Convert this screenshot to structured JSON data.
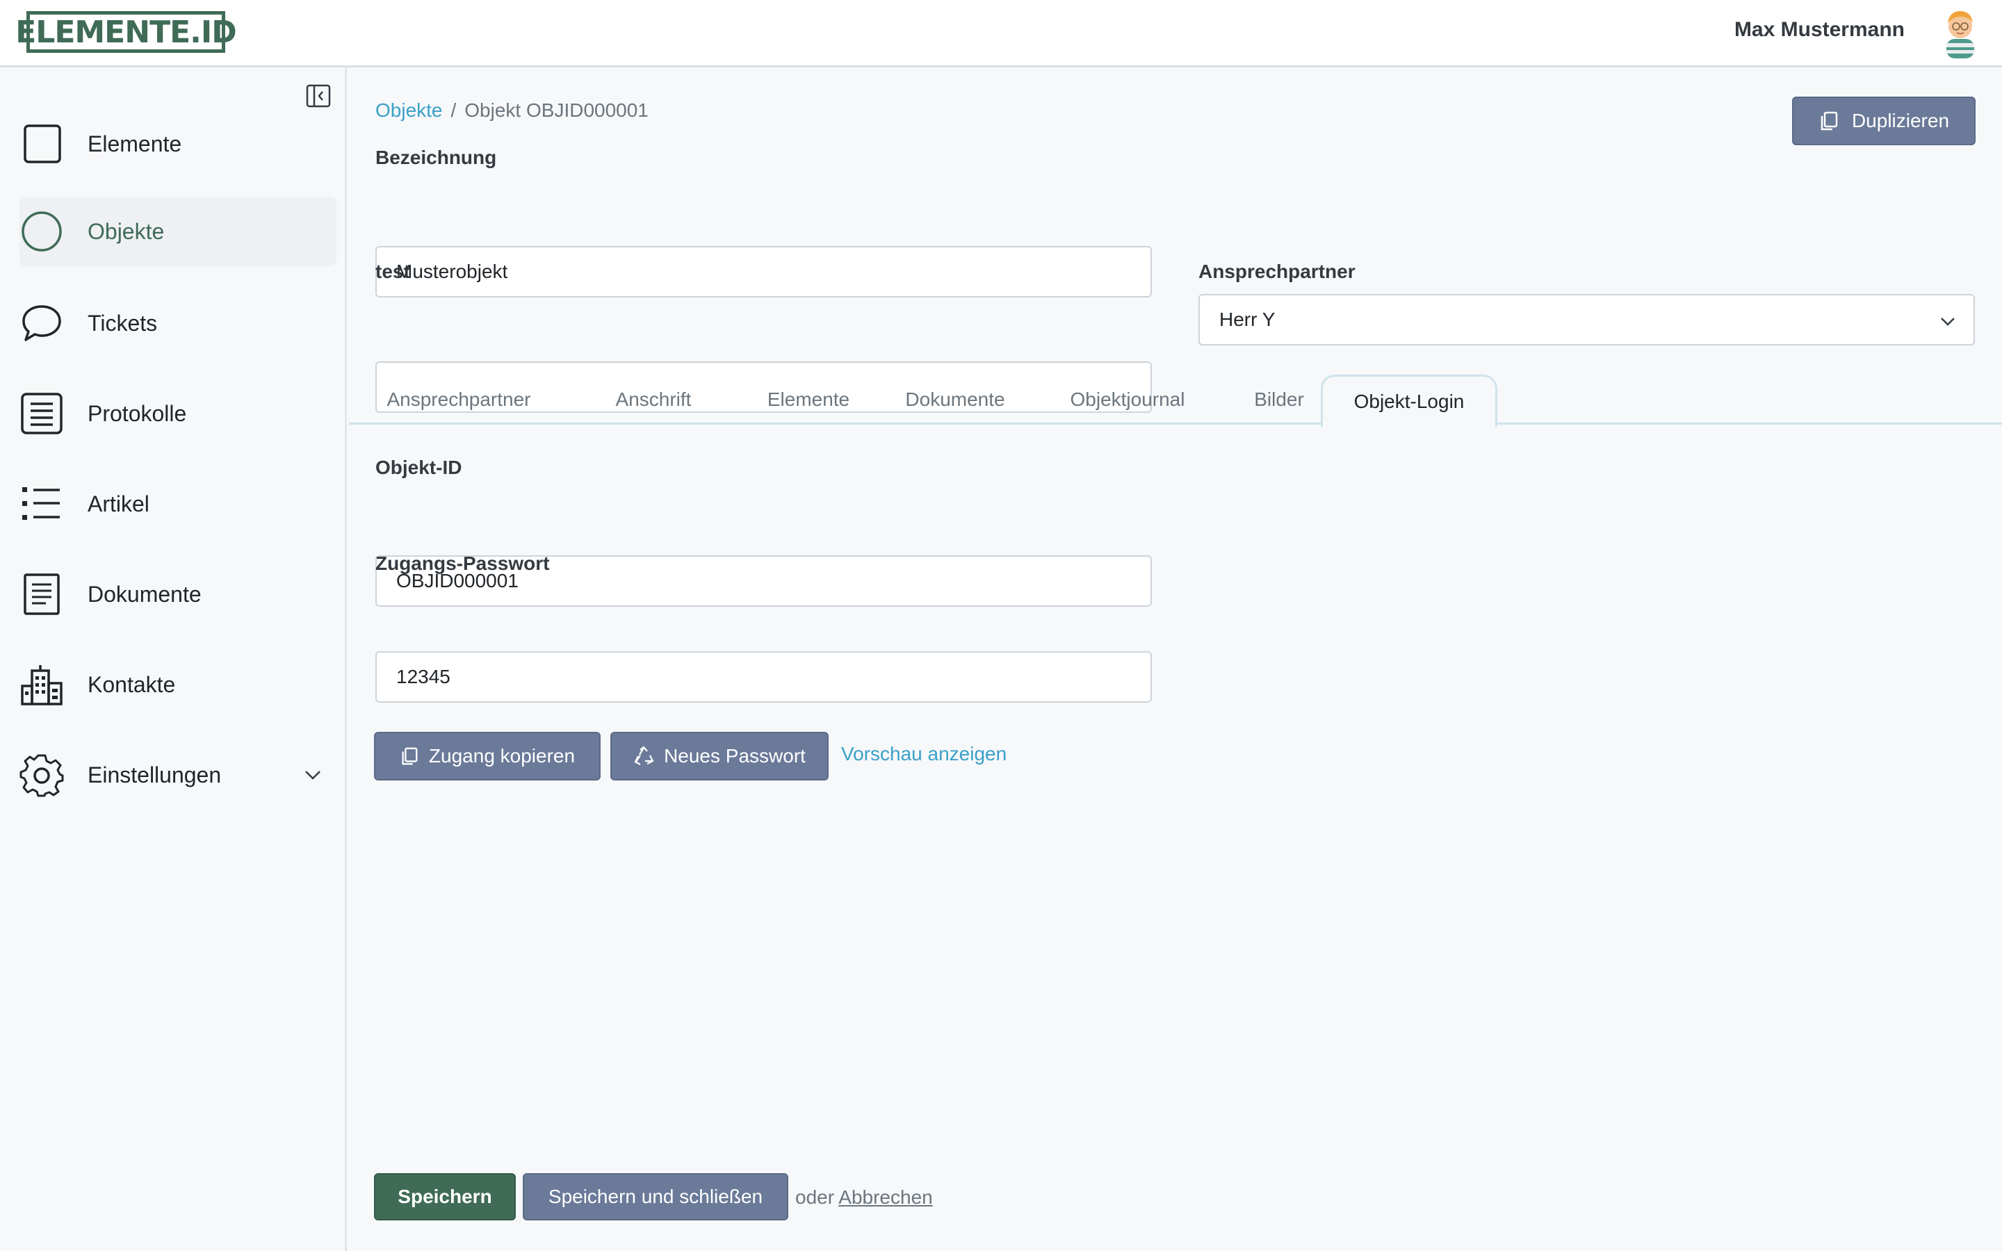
{
  "header": {
    "logo_text": "ELEMENTE.ID",
    "user_name": "Max Mustermann"
  },
  "sidebar": {
    "items": [
      {
        "label": "Elemente",
        "icon": "square-icon"
      },
      {
        "label": "Objekte",
        "icon": "circle-icon",
        "active": true
      },
      {
        "label": "Tickets",
        "icon": "chat-bubble-icon"
      },
      {
        "label": "Protokolle",
        "icon": "list-box-icon"
      },
      {
        "label": "Artikel",
        "icon": "bullet-list-icon"
      },
      {
        "label": "Dokumente",
        "icon": "document-icon"
      },
      {
        "label": "Kontakte",
        "icon": "buildings-icon"
      },
      {
        "label": "Einstellungen",
        "icon": "gear-icon",
        "expandable": true
      }
    ]
  },
  "breadcrumb": {
    "parent": "Objekte",
    "separator": "/",
    "current": "Objekt OBJID000001"
  },
  "toolbar": {
    "duplicate_label": "Duplizieren"
  },
  "form": {
    "bezeichnung_label": "Bezeichnung",
    "bezeichnung_value": "Musterobjekt",
    "test_label": "test",
    "test_value": "",
    "ansprechpartner_label": "Ansprechpartner",
    "ansprechpartner_value": "Herr Y"
  },
  "tabs": [
    {
      "label": "Ansprechpartner"
    },
    {
      "label": "Anschrift"
    },
    {
      "label": "Elemente"
    },
    {
      "label": "Dokumente"
    },
    {
      "label": "Objektjournal"
    },
    {
      "label": "Bilder"
    },
    {
      "label": "Objekt-Login",
      "active": true
    }
  ],
  "login": {
    "objekt_id_label": "Objekt-ID",
    "objekt_id_value": "OBJID000001",
    "password_label": "Zugangs-Passwort",
    "password_value": "12345",
    "copy_button": "Zugang kopieren",
    "new_password_button": "Neues Passwort",
    "preview_link": "Vorschau anzeigen"
  },
  "footer": {
    "save_button": "Speichern",
    "save_close_button": "Speichern und schließen",
    "or_text": "oder",
    "cancel_link": "Abbrechen"
  },
  "colors": {
    "brand": "#3f6b57",
    "link": "#3aa0c8",
    "button_grey": "#6b7a99"
  }
}
